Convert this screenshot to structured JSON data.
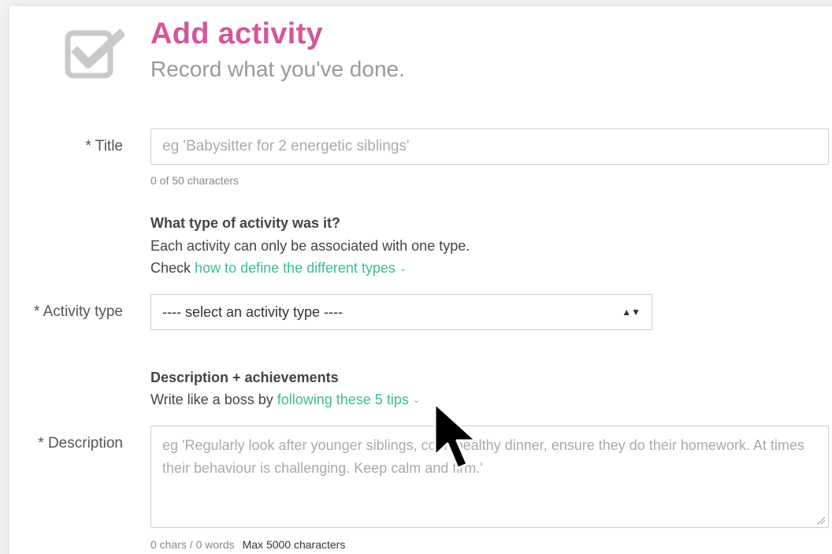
{
  "header": {
    "title": "Add activity",
    "subtitle": "Record what you've done.",
    "icon": "checkbox-check-icon"
  },
  "title_field": {
    "label": "* Title",
    "placeholder": "eg 'Babysitter for 2 energetic siblings'",
    "value": "",
    "counter": "0 of 50 characters"
  },
  "activity_section": {
    "heading": "What type of activity was it?",
    "line1": "Each activity can only be associated with one type.",
    "line2_prefix": "Check ",
    "link": "how to define the different types"
  },
  "activity_type": {
    "label": "* Activity type",
    "selected": "---- select an activity type ----"
  },
  "description_section": {
    "heading": "Description + achievements",
    "prefix": "Write like a boss by ",
    "link": "following these 5 tips"
  },
  "description_field": {
    "label": "* Description",
    "placeholder": "eg 'Regularly look after younger siblings, cook healthy dinner, ensure they do their homework. At times their behaviour is challenging. Keep calm and firm.'",
    "counter": "0 chars / 0 words",
    "max": "Max 5000 characters"
  },
  "colors": {
    "title": "#d4579a",
    "link": "#3bbf8f",
    "background": "#f2f2f2"
  }
}
